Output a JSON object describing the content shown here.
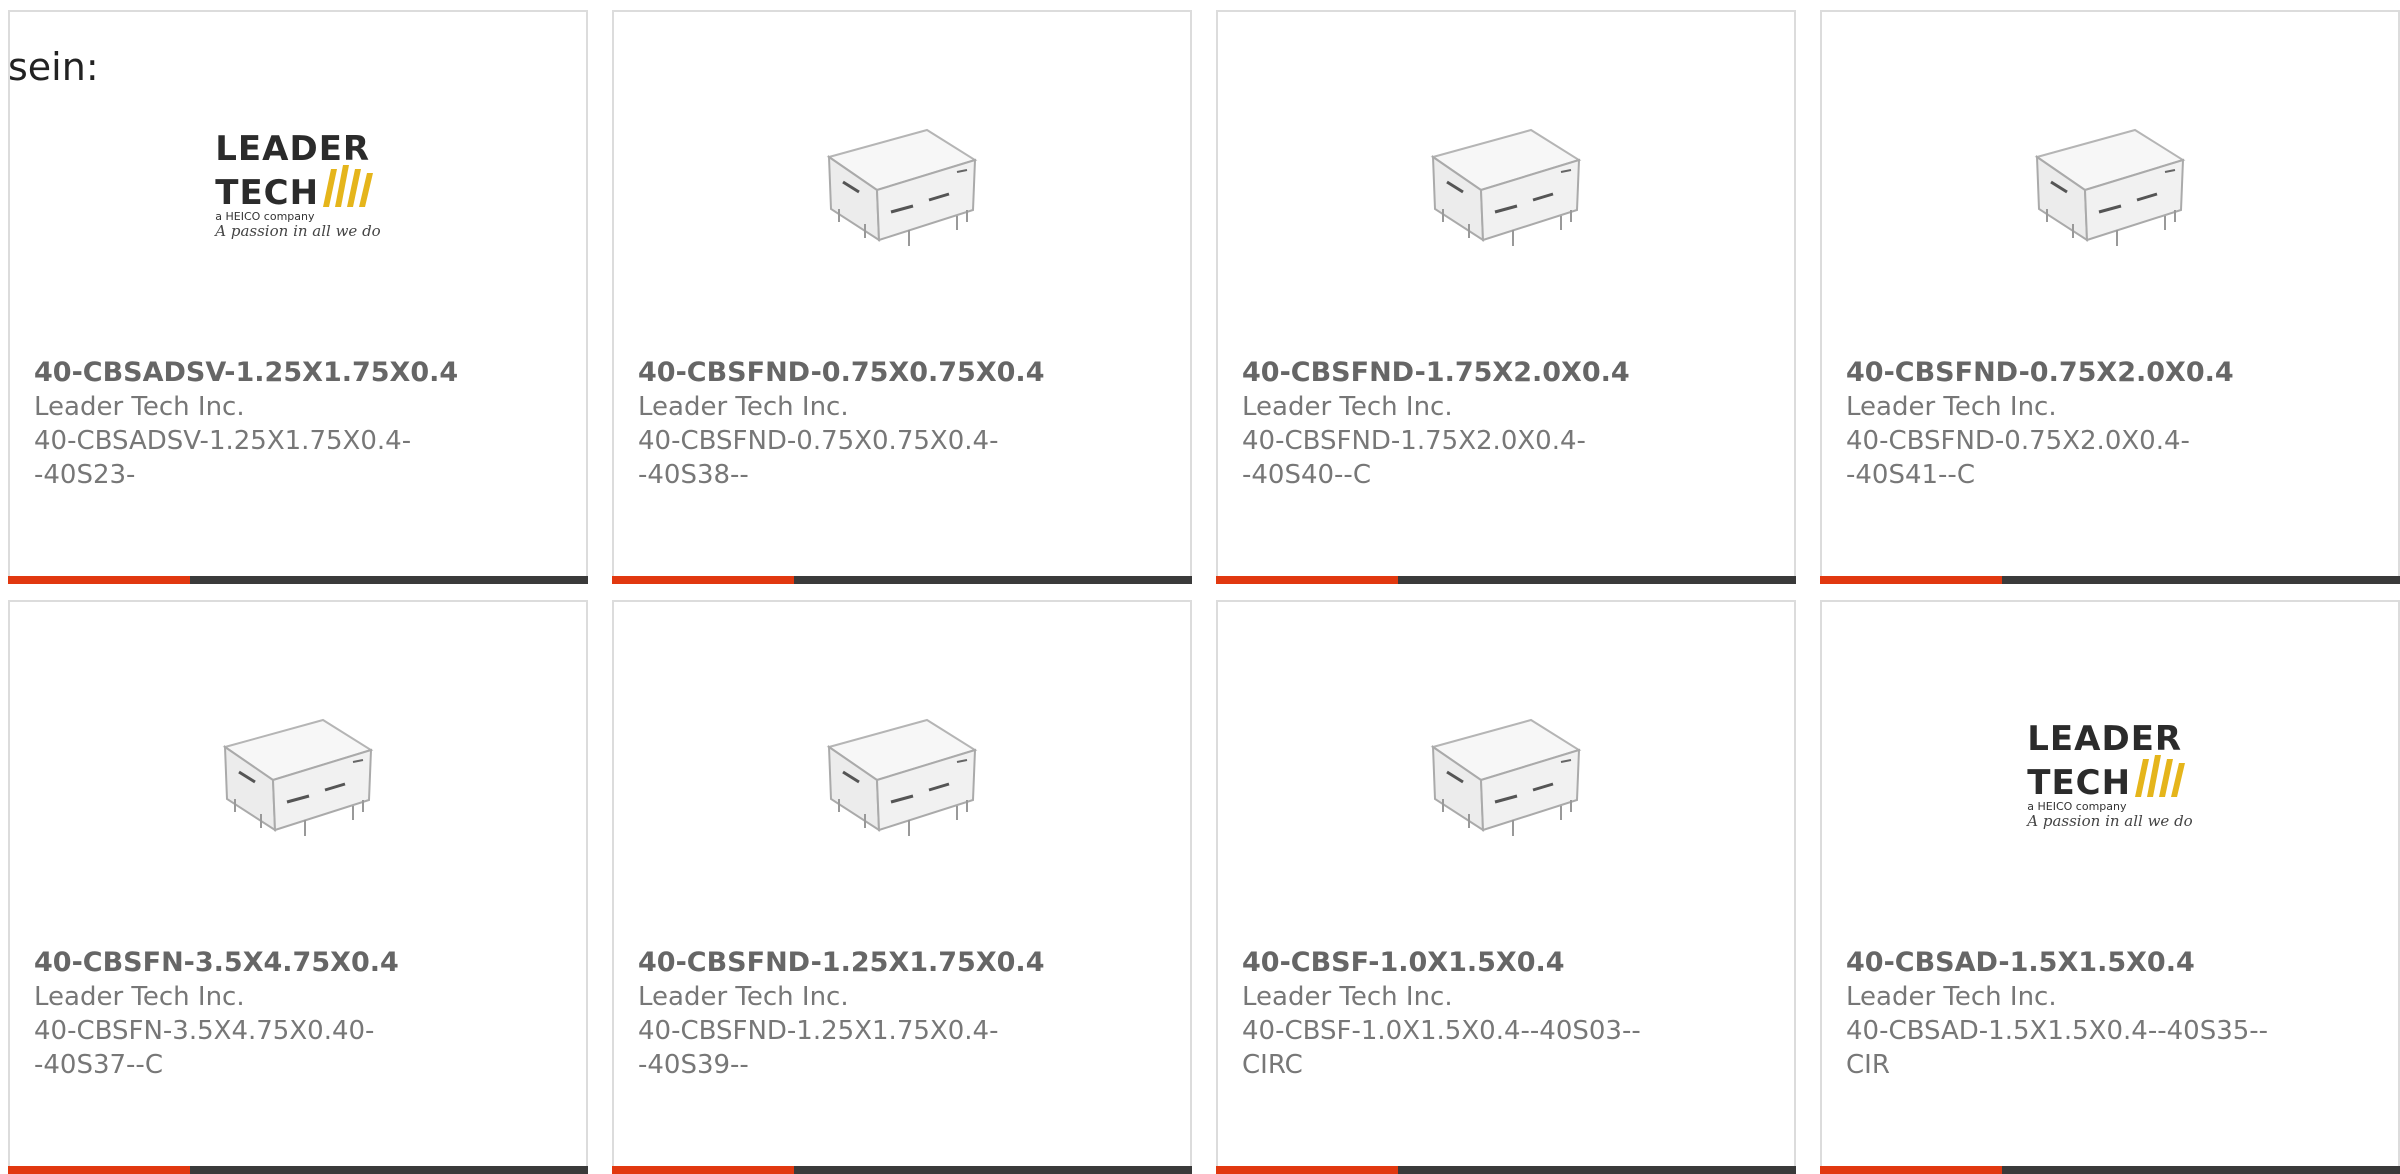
{
  "page": {
    "label": "sein:"
  },
  "logo": {
    "line1": "LEADER",
    "line2": "TECH",
    "company": "a HEICO company",
    "tagline": "A passion in all we do"
  },
  "cards": [
    {
      "title": "40-CBSADSV-1.25X1.75X0.4",
      "maker": "Leader Tech Inc.",
      "desc": "40-CBSADSV-1.25X1.75X0.4--40S23-",
      "image": "leader-tech-logo"
    },
    {
      "title": "40-CBSFND-0.75X0.75X0.4",
      "maker": "Leader Tech Inc.",
      "desc": "40-CBSFND-0.75X0.75X0.4--40S38--",
      "image": "shield-can-photo"
    },
    {
      "title": "40-CBSFND-1.75X2.0X0.4",
      "maker": "Leader Tech Inc.",
      "desc": "40-CBSFND-1.75X2.0X0.4--40S40--C",
      "image": "shield-can-photo"
    },
    {
      "title": "40-CBSFND-0.75X2.0X0.4",
      "maker": "Leader Tech Inc.",
      "desc": "40-CBSFND-0.75X2.0X0.4--40S41--C",
      "image": "shield-can-photo"
    },
    {
      "title": "40-CBSFN-3.5X4.75X0.4",
      "maker": "Leader Tech Inc.",
      "desc": "40-CBSFN-3.5X4.75X0.40--40S37--C",
      "image": "shield-can-photo"
    },
    {
      "title": "40-CBSFND-1.25X1.75X0.4",
      "maker": "Leader Tech Inc.",
      "desc": "40-CBSFND-1.25X1.75X0.4--40S39--",
      "image": "shield-can-photo"
    },
    {
      "title": "40-CBSF-1.0X1.5X0.4",
      "maker": "Leader Tech Inc.",
      "desc": "40-CBSF-1.0X1.5X0.4--40S03--CIRC",
      "image": "shield-can-photo"
    },
    {
      "title": "40-CBSAD-1.5X1.5X0.4",
      "maker": "Leader Tech Inc.",
      "desc": "40-CBSAD-1.5X1.5X0.4--40S35--CIR",
      "image": "leader-tech-logo"
    }
  ],
  "colors": {
    "accent": "#e1380f",
    "bar": "#3a3a3a",
    "border": "#dcdcdc",
    "logo_gold": "#e5b51b"
  }
}
